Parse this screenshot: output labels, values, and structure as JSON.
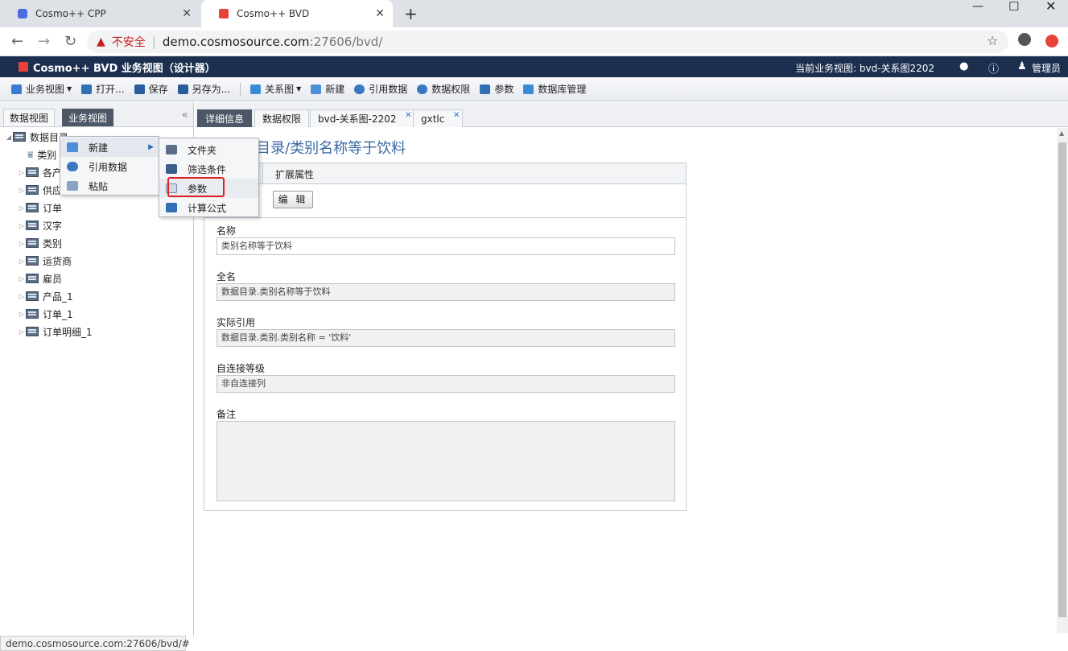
{
  "browser": {
    "tabs": [
      {
        "title": "Cosmo++ CPP"
      },
      {
        "title": "Cosmo++ BVD"
      }
    ],
    "security_label": "不安全",
    "url_host": "demo.cosmosource.com",
    "url_rest": ":27606/bvd/",
    "status_url": "demo.cosmosource.com:27606/bvd/#"
  },
  "app": {
    "title": "Cosmo++ BVD 业务视图（设计器）",
    "current_view": "当前业务视图: bvd-关系图2202",
    "user": "管理员"
  },
  "toolbar": {
    "items": [
      {
        "label": "业务视图",
        "dropdown": true,
        "icon": "view-icon"
      },
      {
        "label": "打开...",
        "icon": "open-icon"
      },
      {
        "label": "保存",
        "icon": "save-icon"
      },
      {
        "label": "另存为...",
        "icon": "save-as-icon"
      },
      {
        "label": "关系图",
        "dropdown": true,
        "icon": "diagram-icon"
      },
      {
        "label": "新建",
        "icon": "new-icon"
      },
      {
        "label": "引用数据",
        "icon": "reference-data-icon"
      },
      {
        "label": "数据权限",
        "icon": "data-permission-icon"
      },
      {
        "label": "参数",
        "icon": "parameter-icon"
      },
      {
        "label": "数据库管理",
        "icon": "database-admin-icon"
      }
    ]
  },
  "left_tabs": [
    "数据视图",
    "业务视图"
  ],
  "tree": {
    "root": "数据目录",
    "filter_item": "类别",
    "items": [
      "各产",
      "供应",
      "订单",
      "汉字",
      "类别",
      "运货商",
      "雇员",
      "产品_1",
      "订单_1",
      "订单明细_1"
    ]
  },
  "right_tabs": [
    {
      "label": "详细信息",
      "active": true,
      "closable": false
    },
    {
      "label": "数据权限",
      "active": false,
      "closable": false
    },
    {
      "label": "bvd-关系图-2202",
      "active": false,
      "closable": true
    },
    {
      "label": "gxtlc",
      "active": false,
      "closable": true
    }
  ],
  "detail": {
    "heading": "据目录/类别名称等于饮料",
    "subtab": "扩展属性",
    "edit_button": "编 辑",
    "fields": [
      {
        "label": "名称",
        "value": "类别名称等于饮料",
        "readonly": false
      },
      {
        "label": "全名",
        "value": "数据目录.类别名称等于饮料",
        "readonly": true
      },
      {
        "label": "实际引用",
        "value": "数据目录.类别.类别名称 = '饮料'",
        "readonly": true
      },
      {
        "label": "自连接等级",
        "value": "非自连接列",
        "readonly": true
      }
    ],
    "remark_label": "备注"
  },
  "context_menu": {
    "items": [
      "新建",
      "引用数据",
      "粘贴"
    ]
  },
  "submenu": {
    "items": [
      "文件夹",
      "筛选条件",
      "参数",
      "计算公式"
    ],
    "highlighted": "参数"
  },
  "colors": {
    "header_bg": "#1c2f4f",
    "active_tab": "#4c5868",
    "highlight_border": "#e02020",
    "heading_text": "#3a69a3"
  }
}
